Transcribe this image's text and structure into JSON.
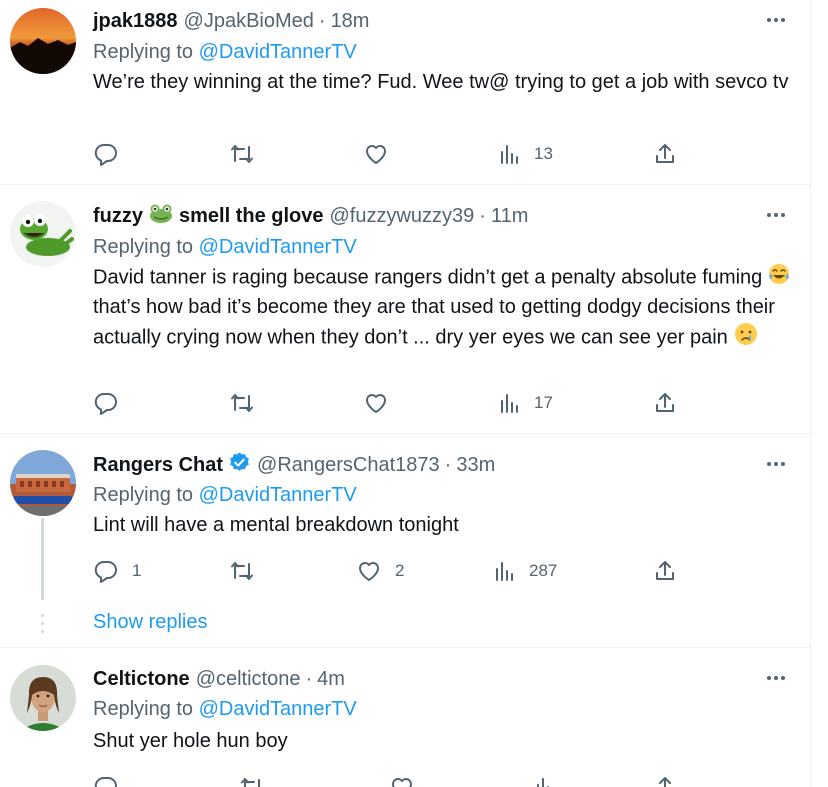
{
  "tweets": [
    {
      "name": "jpak1888",
      "handle": "@JpakBioMed",
      "time": "18m",
      "replying_prefix": "Replying to",
      "replying_to": "@DavidTannerTV",
      "text": "We’re they winning at the time? Fud. Wee tw@ trying to get a job with sevco tv",
      "reply_count": "",
      "retweet_count": "",
      "like_count": "",
      "views": "13"
    },
    {
      "name_part1": "fuzzy",
      "name_emoji": "frog-emoji",
      "name_part2": "smell the glove",
      "handle": "@fuzzywuzzy39",
      "time": "11m",
      "replying_prefix": "Replying to",
      "replying_to": "@DavidTannerTV",
      "text_1": "David tanner is raging because rangers didn’t get a penalty absolute fuming",
      "text_emoji_1": "tears-of-joy-emoji",
      "text_2": " that’s how bad it’s become  they are that used to getting dodgy decisions their actually crying now when they don’t ... dry yer eyes we can see yer pain ",
      "text_emoji_2": "crying-face-emoji",
      "reply_count": "",
      "retweet_count": "",
      "like_count": "",
      "views": "17"
    },
    {
      "name": "Rangers Chat",
      "verified_icon": "verified-badge-icon",
      "handle": "@RangersChat1873",
      "time": "33m",
      "replying_prefix": "Replying to",
      "replying_to": "@DavidTannerTV",
      "text": "Lint will have a mental breakdown tonight",
      "reply_count": "1",
      "retweet_count": "",
      "like_count": "2",
      "views": "287"
    },
    {
      "name": "Celtictone",
      "handle": "@celtictone",
      "time": "4m",
      "replying_prefix": "Replying to",
      "replying_to": "@DavidTannerTV",
      "text": "Shut yer hole hun boy"
    }
  ],
  "show_replies": "Show replies",
  "separator": "·",
  "colors": {
    "link": "#1d9bf0",
    "secondary_text": "#536471",
    "primary_text": "#0f1419",
    "border": "#eff3f4",
    "verified": "#1d9bf0"
  },
  "icons": {
    "reply": "reply-icon",
    "retweet": "retweet-icon",
    "like": "like-icon",
    "views": "views-icon",
    "share": "share-icon",
    "more": "more-icon"
  }
}
